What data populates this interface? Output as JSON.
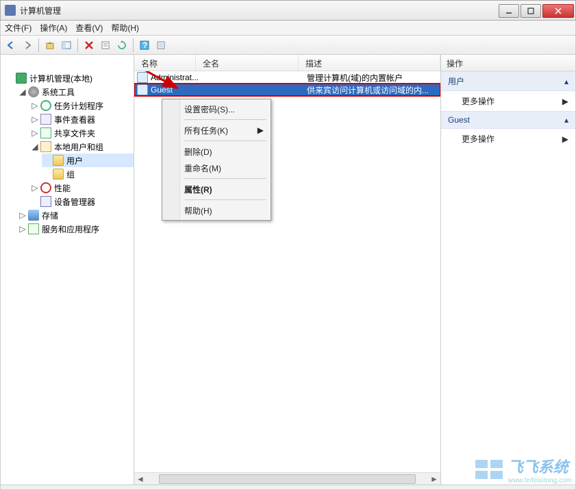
{
  "window": {
    "title": "计算机管理"
  },
  "menu": {
    "file": "文件(F)",
    "action": "操作(A)",
    "view": "查看(V)",
    "help": "帮助(H)"
  },
  "tree": {
    "root": "计算机管理(本地)",
    "systools": "系统工具",
    "tasksched": "任务计划程序",
    "eventvwr": "事件查看器",
    "shared": "共享文件夹",
    "localusers": "本地用户和组",
    "users": "用户",
    "groups": "组",
    "perf": "性能",
    "devmgr": "设备管理器",
    "storage": "存储",
    "services": "服务和应用程序"
  },
  "list": {
    "cols": {
      "name": "名称",
      "full": "全名",
      "desc": "描述"
    },
    "rows": [
      {
        "name": "Administrat...",
        "full": "",
        "desc": "管理计算机(域)的内置帐户"
      },
      {
        "name": "Guest",
        "full": "",
        "desc": "供来宾访问计算机或访问域的内..."
      }
    ]
  },
  "ctx": {
    "setpwd": "设置密码(S)...",
    "alltasks": "所有任务(K)",
    "delete": "删除(D)",
    "rename": "重命名(M)",
    "props": "属性(R)",
    "help": "帮助(H)"
  },
  "actions": {
    "header": "操作",
    "group1": "用户",
    "more1": "更多操作",
    "group2": "Guest",
    "more2": "更多操作"
  },
  "watermark": {
    "brand": "飞飞系统",
    "url": "www.feifeixitong.com"
  }
}
